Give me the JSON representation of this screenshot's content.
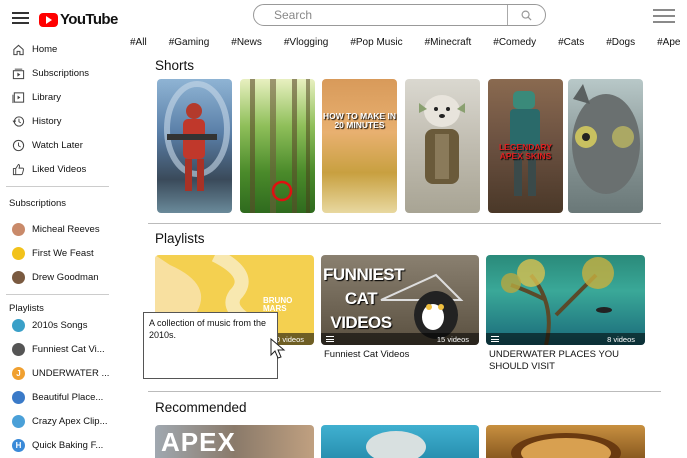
{
  "header": {
    "logo_text": "YouTube",
    "search_placeholder": "Search"
  },
  "chips": [
    "#All",
    "#Gaming",
    "#News",
    "#Vlogging",
    "#Pop Music",
    "#Minecraft",
    "#Comedy",
    "#Cats",
    "#Dogs",
    "#Ape"
  ],
  "sidebar": {
    "nav": [
      {
        "label": "Home",
        "icon": "home-icon"
      },
      {
        "label": "Subscriptions",
        "icon": "subscriptions-icon"
      },
      {
        "label": "Library",
        "icon": "library-icon"
      },
      {
        "label": "History",
        "icon": "history-icon"
      },
      {
        "label": "Watch Later",
        "icon": "clock-icon"
      },
      {
        "label": "Liked Videos",
        "icon": "thumbs-up-icon"
      }
    ],
    "subscriptions_title": "Subscriptions",
    "subscriptions": [
      {
        "label": "Micheal Reeves",
        "color": "#c98a6a"
      },
      {
        "label": "First We Feast",
        "color": "#f2c21b"
      },
      {
        "label": "Drew Goodman",
        "color": "#7a5a40"
      }
    ],
    "playlists_title": "Playlists",
    "playlists": [
      {
        "label": "2010s Songs",
        "color": "#3aa0c8",
        "letter": ""
      },
      {
        "label": "Funniest Cat Vi...",
        "color": "#555555",
        "letter": ""
      },
      {
        "label": "UNDERWATER ...",
        "color": "#f0a030",
        "letter": "J"
      },
      {
        "label": "Beautiful Place...",
        "color": "#3a7ac8",
        "letter": ""
      },
      {
        "label": "Crazy Apex Clip...",
        "color": "#4aa0d8",
        "letter": ""
      },
      {
        "label": "Quick Baking F...",
        "color": "#3a8ad8",
        "letter": "H"
      }
    ]
  },
  "sections": {
    "shorts": "Shorts",
    "playlists": "Playlists",
    "recommended": "Recommended"
  },
  "shorts": [
    {
      "caption": ""
    },
    {
      "caption": ""
    },
    {
      "caption": "HOW TO MAKE IN 20 MINUTES"
    },
    {
      "caption": ""
    },
    {
      "caption": "LEGENDARY APEX SKINS"
    },
    {
      "caption": ""
    }
  ],
  "playlist_cards": [
    {
      "title": "",
      "count": "30 videos",
      "art_text": "BRUNO MARS"
    },
    {
      "title": "Funniest Cat Videos",
      "count": "15 videos",
      "art_text": "FUNNIEST CAT VIDEOS"
    },
    {
      "title": "UNDERWATER PLACES YOU SHOULD VISIT",
      "count": "8 videos",
      "art_text": ""
    }
  ],
  "recommended": [
    {
      "art_text": "APEX"
    },
    {
      "art_text": ""
    },
    {
      "art_text": ""
    }
  ],
  "tooltip": "A collection of music from the 2010s."
}
